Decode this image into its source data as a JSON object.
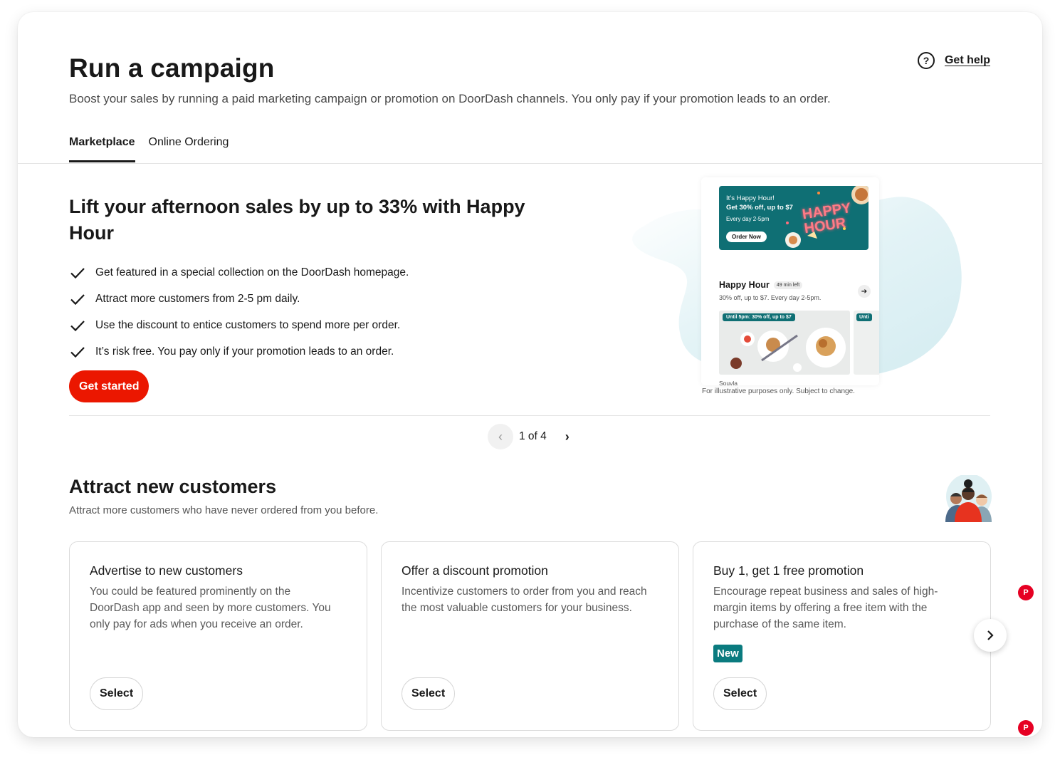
{
  "header": {
    "title": "Run a campaign",
    "subtitle": "Boost your sales by running a paid marketing campaign or promotion on DoorDash channels. You only pay if your promotion leads to an order.",
    "help_icon": "?",
    "help_label": "Get help"
  },
  "tabs": [
    {
      "label": "Marketplace",
      "active": true
    },
    {
      "label": "Online Ordering",
      "active": false
    }
  ],
  "hero": {
    "title": "Lift your afternoon sales by up to 33% with Happy Hour",
    "benefits": [
      "Get featured in a special collection on the DoorDash homepage.",
      "Attract more customers from 2-5 pm daily.",
      "Use the discount to entice customers to spend more per order.",
      "It’s risk free. You pay only if your promotion leads to an order."
    ],
    "cta_label": "Get started",
    "illustration": {
      "banner_line1": "It’s Happy Hour!",
      "banner_line2": "Get 30% off, up to $7",
      "banner_line3": "Every day 2-5pm",
      "banner_button": "Order Now",
      "banner_logo": "HAPPY HOUR",
      "store_name": "Happy Hour",
      "store_badge": "49 min left",
      "store_desc": "30% off, up to $7. Every day 2-5pm.",
      "food_tag": "Until 5pm: 30% off, up to $7",
      "food_tag_2": "Unti",
      "store_2": "Souvla"
    },
    "disclaimer": "For illustrative purposes only. Subject to change."
  },
  "pager": {
    "text": "1 of 4"
  },
  "section": {
    "title": "Attract new customers",
    "subtitle": "Attract more customers who have never ordered from you before.",
    "cards": [
      {
        "title": "Advertise to new customers",
        "description": "You could be featured prominently on the DoorDash app and seen by more customers. You only pay for ads when you receive an order.",
        "badge": "",
        "button": "Select"
      },
      {
        "title": "Offer a discount promotion",
        "description": "Incentivize customers to order from you and reach the most valuable customers for your business.",
        "badge": "",
        "button": "Select"
      },
      {
        "title": "Buy 1, get 1 free promotion",
        "description": "Encourage repeat business and sales of high-margin items by offering a free item with the purchase of the same item.",
        "badge": "New",
        "button": "Select"
      }
    ]
  },
  "pin_label": "P",
  "colors": {
    "brand_red": "#eb1700",
    "teal_badge": "#0a7b7f",
    "text": "#191919",
    "muted": "#595959"
  },
  "icons": {
    "help": "question-circle-icon",
    "check": "check-icon",
    "prev": "chevron-left-icon",
    "next": "chevron-right-icon"
  }
}
